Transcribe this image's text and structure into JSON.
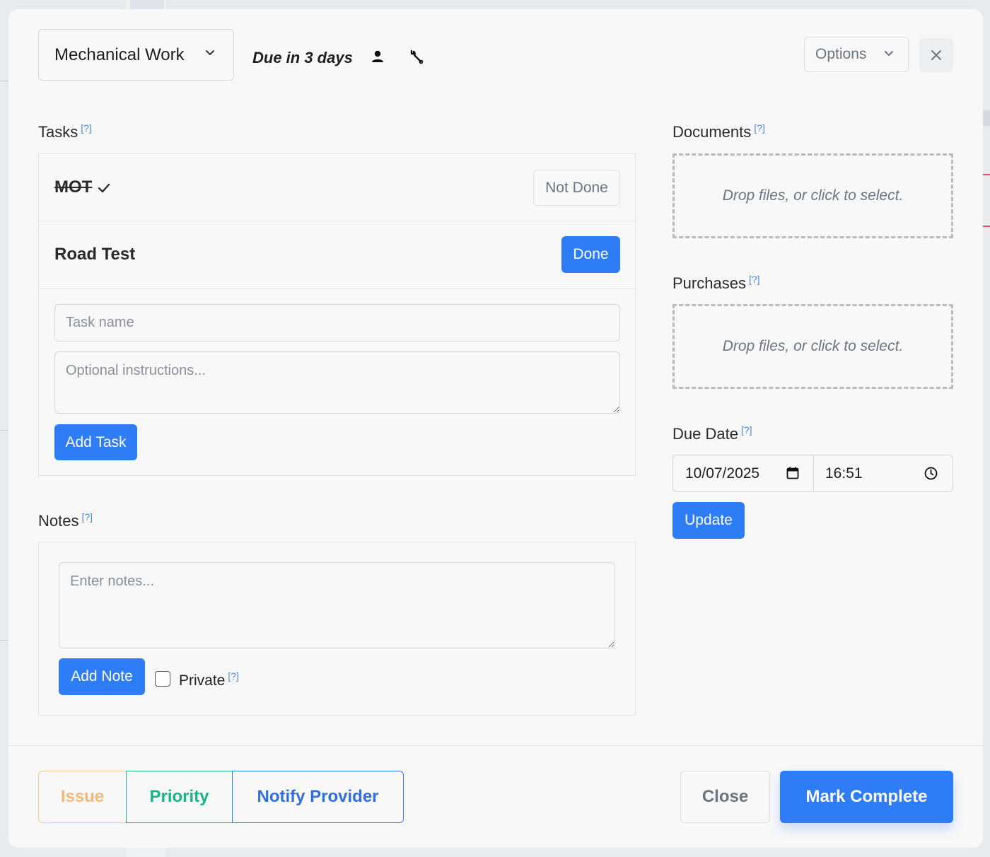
{
  "header": {
    "job_type": "Mechanical Work",
    "due_status": "Due in 3 days",
    "options_label": "Options"
  },
  "tasks": {
    "label": "Tasks",
    "help": "[?]",
    "items": [
      {
        "name": "MOT",
        "completed": true,
        "action_label": "Not Done"
      },
      {
        "name": "Road Test",
        "completed": false,
        "action_label": "Done"
      }
    ],
    "task_name_placeholder": "Task name",
    "instructions_placeholder": "Optional instructions...",
    "add_task_label": "Add Task"
  },
  "notes": {
    "label": "Notes",
    "help": "[?]",
    "placeholder": "Enter notes...",
    "add_note_label": "Add Note",
    "private_label": "Private",
    "private_checked": false
  },
  "documents": {
    "label": "Documents",
    "help": "[?]",
    "dropzone_text": "Drop files, or click to select."
  },
  "purchases": {
    "label": "Purchases",
    "help": "[?]",
    "dropzone_text": "Drop files, or click to select."
  },
  "due_date": {
    "label": "Due Date",
    "help": "[?]",
    "date": "10/07/2025",
    "time": "16:51",
    "update_label": "Update"
  },
  "footer": {
    "issue_label": "Issue",
    "priority_label": "Priority",
    "notify_label": "Notify Provider",
    "close_label": "Close",
    "complete_label": "Mark Complete"
  },
  "colors": {
    "primary": "#2f7df6",
    "issue": "#f4b97a",
    "priority": "#16b489",
    "muted": "#6b7480"
  }
}
